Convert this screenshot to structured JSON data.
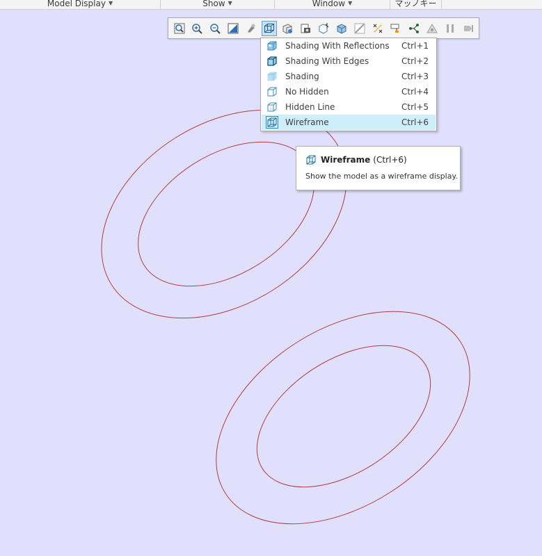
{
  "ribbon": {
    "groups": [
      {
        "label": "Model Display",
        "has_menu": true
      },
      {
        "label": "Show",
        "has_menu": true
      },
      {
        "label": "Window",
        "has_menu": true
      },
      {
        "label": "マッノキー",
        "has_menu": false
      }
    ]
  },
  "toolbar": {
    "buttons": [
      {
        "icon": "refit-icon"
      },
      {
        "icon": "zoom-in-icon"
      },
      {
        "icon": "zoom-out-icon"
      },
      {
        "icon": "repaint-icon"
      },
      {
        "icon": "saved-orientations-icon"
      },
      {
        "icon": "display-style-icon",
        "active": true
      },
      {
        "icon": "view-manager-icon"
      },
      {
        "icon": "perspective-view-icon"
      },
      {
        "icon": "section-icon"
      },
      {
        "icon": "datum-display-icon"
      },
      {
        "icon": "annotation-display-icon"
      },
      {
        "icon": "spin-center-icon"
      },
      {
        "icon": "csys-display-icon"
      },
      {
        "icon": "point-display-icon"
      },
      {
        "icon": "display-state-icon"
      },
      {
        "icon": "pause-icon"
      },
      {
        "icon": "next-icon"
      }
    ]
  },
  "display_style_menu": {
    "items": [
      {
        "label": "Shading With Reflections",
        "shortcut": "Ctrl+1",
        "icon": "shading-reflections-icon"
      },
      {
        "label": "Shading With Edges",
        "shortcut": "Ctrl+2",
        "icon": "shading-edges-icon"
      },
      {
        "label": "Shading",
        "shortcut": "Ctrl+3",
        "icon": "shading-icon"
      },
      {
        "label": "No Hidden",
        "shortcut": "Ctrl+4",
        "icon": "no-hidden-icon"
      },
      {
        "label": "Hidden Line",
        "shortcut": "Ctrl+5",
        "icon": "hidden-line-icon"
      },
      {
        "label": "Wireframe",
        "shortcut": "Ctrl+6",
        "icon": "wireframe-icon",
        "selected": true
      }
    ]
  },
  "tooltip": {
    "title": "Wireframe",
    "shortcut": "(Ctrl+6)",
    "description": "Show the model as a wireframe display."
  },
  "colors": {
    "canvas_background": "#e0e0fc",
    "geometry_edge": "#b03a48",
    "menu_selected": "#cfeefb"
  }
}
